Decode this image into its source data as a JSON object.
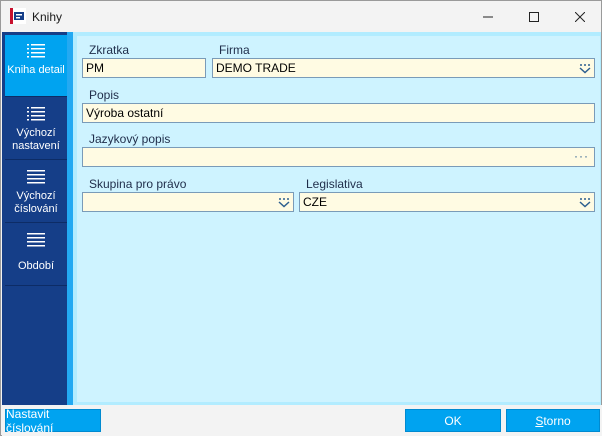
{
  "window": {
    "title": "Knihy",
    "controls": {
      "minimize_icon": "minimize-icon",
      "maximize_icon": "maximize-icon",
      "close_icon": "close-icon"
    }
  },
  "sidebar": {
    "items": [
      {
        "label": "Kniha detail",
        "icon": "menu-icon",
        "active": true
      },
      {
        "label": "Výchozí nastavení",
        "icon": "menu-icon",
        "active": false
      },
      {
        "label": "Výchozí číslování",
        "icon": "menu-icon",
        "active": false
      },
      {
        "label": "Období",
        "icon": "menu-icon",
        "active": false
      }
    ]
  },
  "form": {
    "zkratka": {
      "label": "Zkratka",
      "value": "PM"
    },
    "firma": {
      "label": "Firma",
      "value": "DEMO TRADE"
    },
    "popis": {
      "label": "Popis",
      "value": "Výroba ostatní"
    },
    "jazykovy_popis": {
      "label": "Jazykový popis",
      "value": "",
      "button": "···"
    },
    "skupina": {
      "label": "Skupina pro právo",
      "value": ""
    },
    "legislativa": {
      "label": "Legislativa",
      "value": "CZE"
    }
  },
  "footer": {
    "numbering_label": "Nastavit číslování",
    "ok_label": "OK",
    "cancel_prefix": "S",
    "cancel_rest": "torno"
  },
  "colors": {
    "sidebar_bg": "#153e88",
    "sidebar_active": "#00a3f0",
    "accent": "#23a9f2",
    "panel_bg": "#cef3ff",
    "input_bg": "#fffbe3",
    "button_bg": "#00a3f0"
  }
}
